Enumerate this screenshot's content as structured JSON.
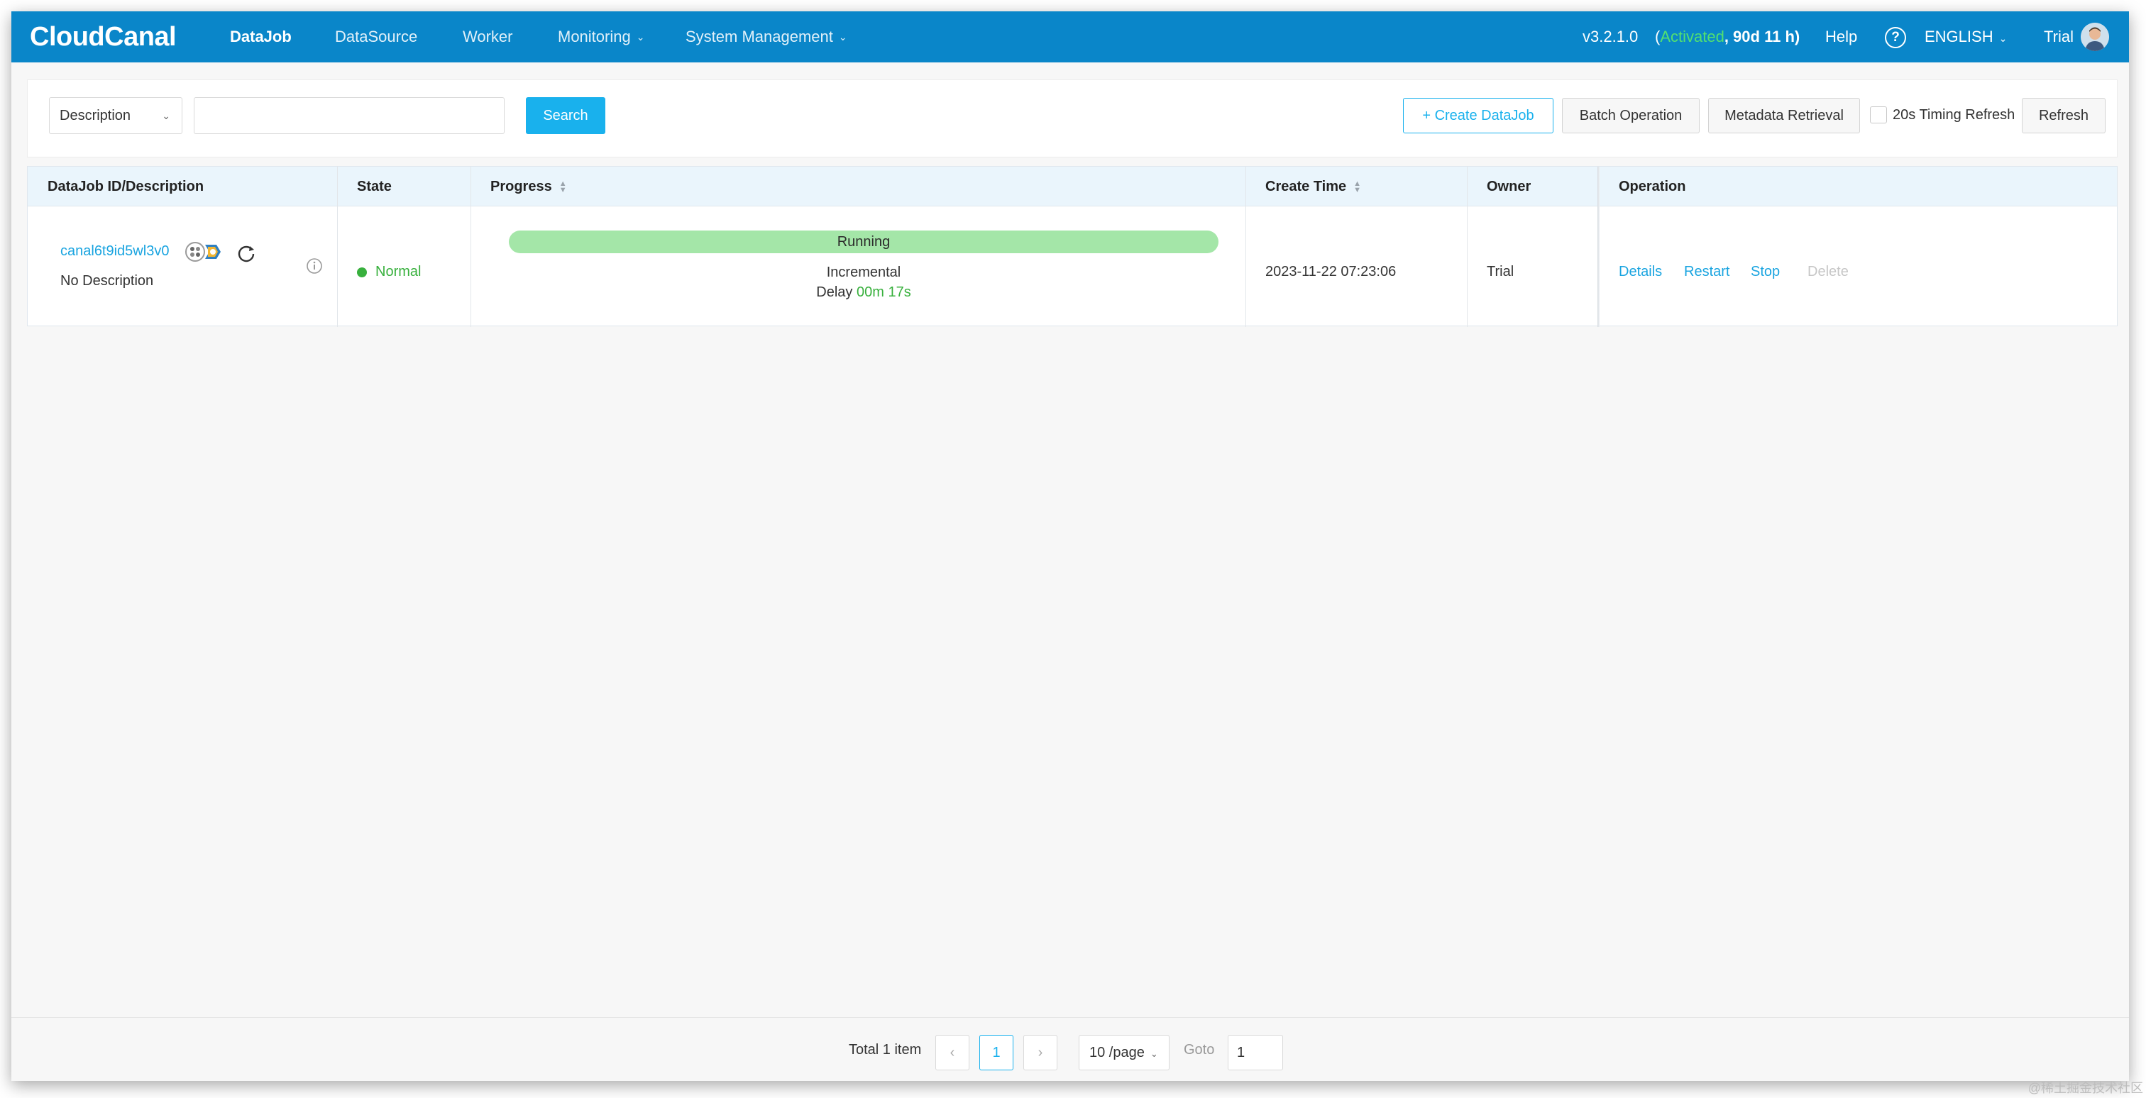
{
  "header": {
    "logo_text": "CloudCanal",
    "nav": [
      {
        "label": "DataJob",
        "active": true
      },
      {
        "label": "DataSource",
        "active": false
      },
      {
        "label": "Worker",
        "active": false
      },
      {
        "label": "Monitoring",
        "has_dropdown": true
      },
      {
        "label": "System Management",
        "has_dropdown": true
      }
    ],
    "version": "v3.2.1.0",
    "license_open": "(",
    "license_status": "Activated",
    "license_remaining": ", 90d 11 h)",
    "help_label": "Help",
    "help_icon": "?",
    "language": "ENGLISH",
    "user": "Trial",
    "brand_color": "#0a86c9"
  },
  "toolbar": {
    "filter_select": "Description",
    "search_input_value": "",
    "search_button": "Search",
    "create_button": "+ Create DataJob",
    "batch_button": "Batch Operation",
    "metadata_button": "Metadata Retrieval",
    "timing_refresh_label": "20s Timing Refresh",
    "timing_refresh_checked": false,
    "refresh_button": "Refresh"
  },
  "table": {
    "columns": {
      "id": "DataJob ID/Description",
      "state": "State",
      "progress": "Progress",
      "create_time": "Create Time",
      "owner": "Owner",
      "operation": "Operation"
    },
    "rows": [
      {
        "id": "canal6t9id5wl3v0",
        "description": "No Description",
        "source_icon": "database-source-icon",
        "target_icon": "database-target-icon",
        "state": "Normal",
        "state_color": "#38b03d",
        "progress_label": "Running",
        "phase": "Incremental",
        "delay_label": "Delay",
        "delay_value": "00m 17s",
        "create_time": "2023-11-22 07:23:06",
        "owner": "Trial",
        "ops": {
          "details": "Details",
          "restart": "Restart",
          "stop": "Stop",
          "delete": "Delete"
        }
      }
    ]
  },
  "pagination": {
    "total": "Total 1 item",
    "prev": "‹",
    "current_page": "1",
    "next": "›",
    "page_size": "10 /page",
    "goto_label": "Goto",
    "goto_value": "1"
  },
  "watermark": "@稀土掘金技术社区"
}
